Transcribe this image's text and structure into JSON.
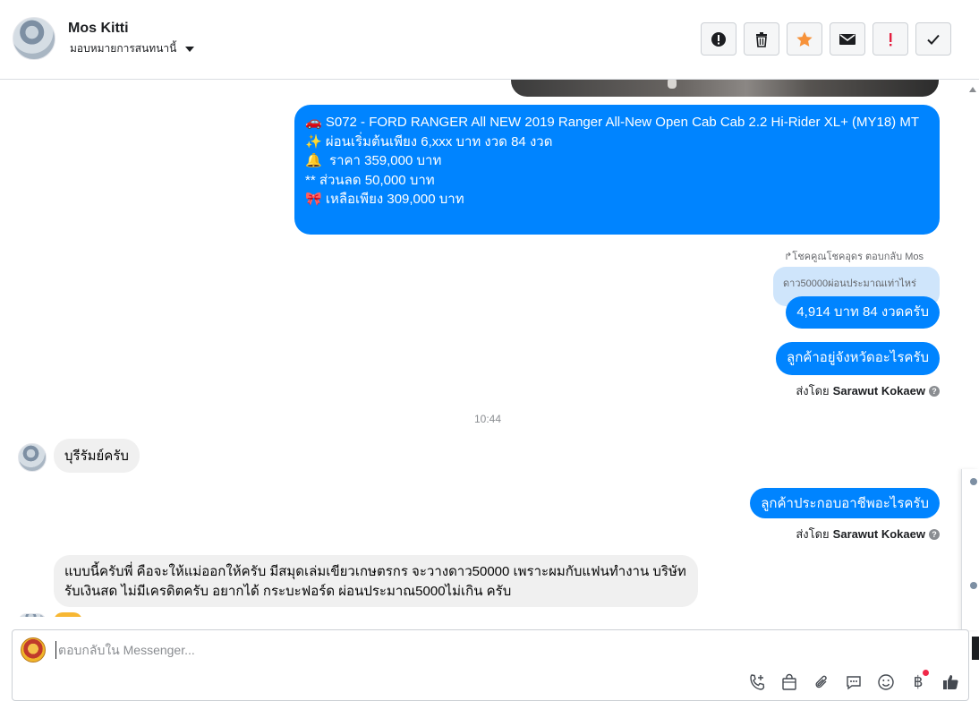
{
  "header": {
    "contact_name": "Mos Kitti",
    "assign_label": "มอบหมายการสนทนานี้",
    "toolbar": [
      {
        "name": "mark-spam-button",
        "icon": "alert-circle-icon"
      },
      {
        "name": "delete-button",
        "icon": "trash-icon"
      },
      {
        "name": "star-button",
        "icon": "star-icon"
      },
      {
        "name": "mark-unread-button",
        "icon": "envelope-icon"
      },
      {
        "name": "follow-up-button",
        "icon": "exclamation-icon"
      },
      {
        "name": "mark-done-button",
        "icon": "check-icon"
      }
    ]
  },
  "thread": {
    "listing_lines": [
      "🚗 S072 - FORD RANGER All NEW 2019 Ranger All-New Open Cab Cab 2.2 Hi-Rider XL+ (MY18) MT",
      "✨ ผ่อนเริ่มต้นเพียง 6,xxx บาท งวด 84 งวด",
      "🔔  ราคา 359,000 บาท",
      "** ส่วนลด 50,000 บาท",
      "🎀 เหลือเพียง 309,000 บาท"
    ],
    "reply_header": "↱โชคคูณโชคอุดร ตอบกลับ Mos",
    "quoted_text": "ดาว50000ผ่อนประมาณเท่าไหร่",
    "reply_answer": "4,914 บาท 84 งวดครับ",
    "ask_province": "ลูกค้าอยู่จังหวัดอะไรครับ",
    "sent_by_prefix": "ส่งโดย",
    "sent_by_name": "Sarawut Kokaew",
    "help_mark": "?",
    "timestamp": "10:44",
    "customer_province": "บุรีรัมย์ครับ",
    "ask_occupation": "ลูกค้าประกอบอาชีพอะไรครับ",
    "customer_long_message": "แบบนี้ครับพี่ คือจะให้แม่ออกให้ครับ มีสมุดเล่มเขียวเกษตรกร จะวางดาว50000 เพราะผมกับแฟนทำงาน บริษัทรับเงินสด ไม่มีเครดิตครับ อยากได้ กระบะฟอร์ด ผ่อนประมาณ5000ไม่เกิน ครับ"
  },
  "composer": {
    "placeholder": "ตอบกลับใน Messenger...",
    "tools": [
      {
        "name": "add-contact-tool",
        "icon": "phone-plus-icon"
      },
      {
        "name": "shop-tool",
        "icon": "shopping-bag-icon"
      },
      {
        "name": "attach-tool",
        "icon": "paperclip-icon"
      },
      {
        "name": "saved-replies-tool",
        "icon": "chat-bubble-icon"
      },
      {
        "name": "emoji-tool",
        "icon": "smiley-icon"
      },
      {
        "name": "payment-tool",
        "icon": "baht-icon"
      },
      {
        "name": "like-tool",
        "icon": "thumbs-up-icon"
      }
    ]
  },
  "colors": {
    "outgoing_bubble": "#0084ff",
    "incoming_bubble": "#f0f0f0",
    "quoted_bubble": "#cfe5fb",
    "star": "#f7923a",
    "follow_up": "#e41e3f"
  }
}
